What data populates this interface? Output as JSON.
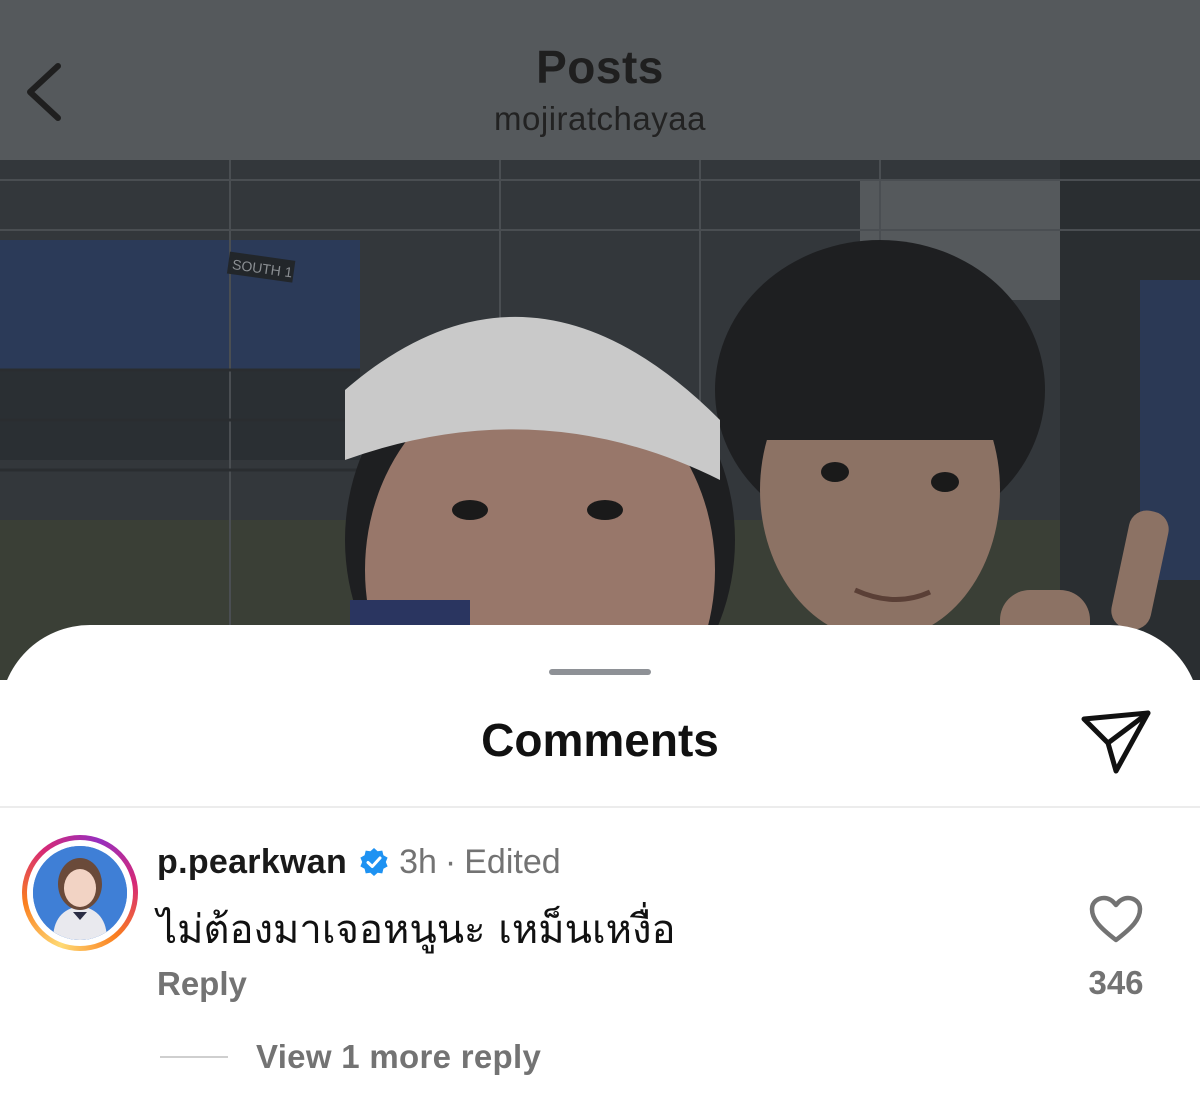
{
  "header": {
    "title": "Posts",
    "username": "mojiratchayaa",
    "back_icon": "chevron-left-icon"
  },
  "post": {
    "photo_description": "Two people posing for a selfie in front of a fenced sports court, one wearing a white visor and the other making a peace sign",
    "overlay_color": "#55595c",
    "court_sign": "SOUTH 1"
  },
  "comments_sheet": {
    "title": "Comments",
    "share_icon": "paper-plane-icon"
  },
  "comments": [
    {
      "username": "p.pearkwan",
      "verified": true,
      "verified_color": "#1e92f2",
      "time": "3h",
      "separator": "·",
      "edited_label": "Edited",
      "text": "ไม่ต้องมาเจอหนูนะ เหม็นเหงื่อ",
      "reply_label": "Reply",
      "like_icon": "heart-outline-icon",
      "like_count": "346",
      "view_replies_label": "View 1 more reply"
    }
  ],
  "colors": {
    "secondary_text": "#737373",
    "primary_text": "#111111",
    "story_ring": [
      "#feda75",
      "#fa7e1e",
      "#d62976",
      "#962fbf"
    ]
  }
}
